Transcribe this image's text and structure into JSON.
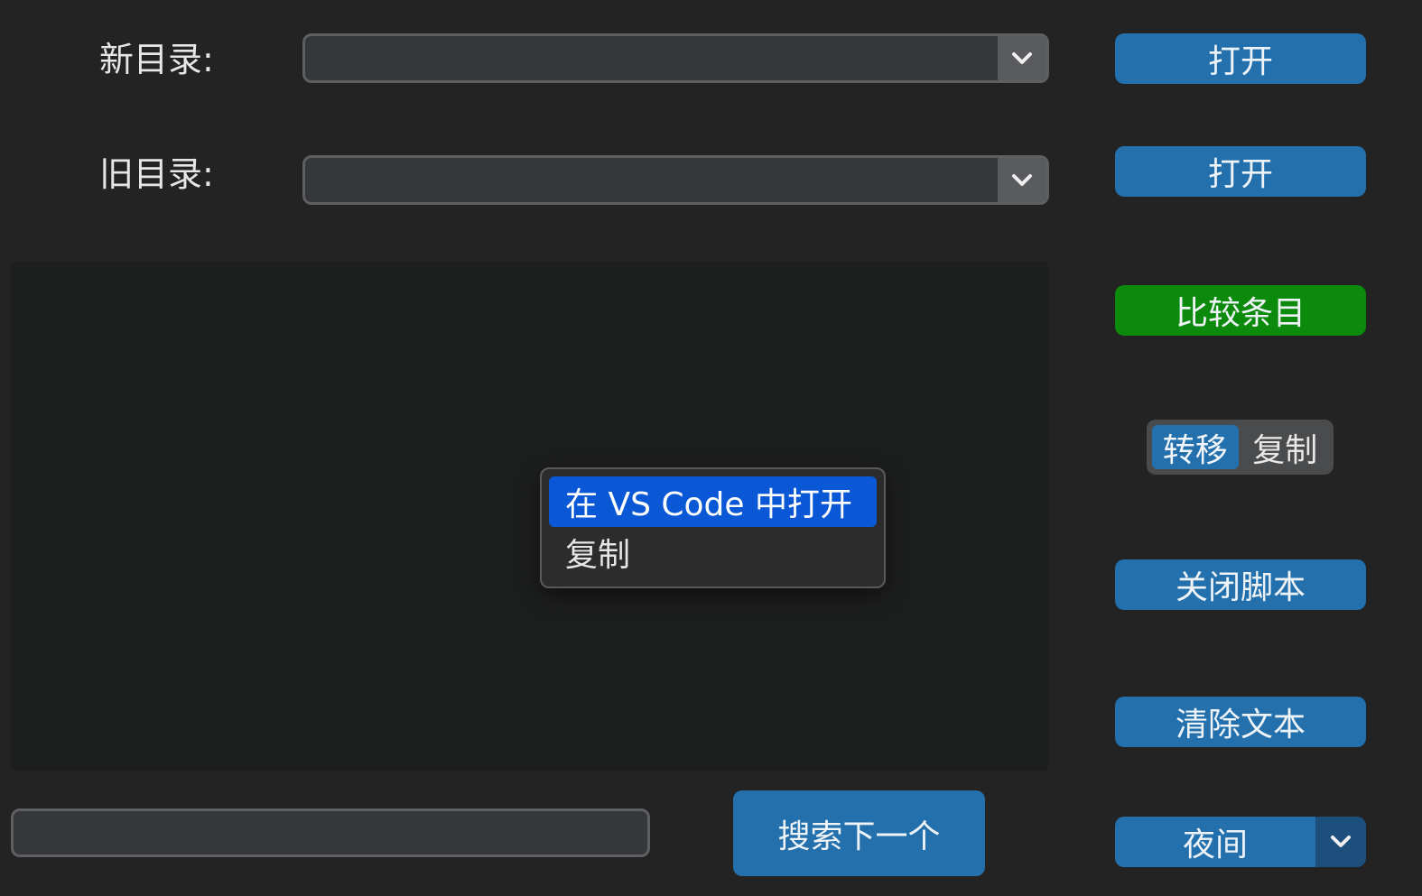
{
  "form": {
    "new_dir_label": "新目录:",
    "old_dir_label": "旧目录:",
    "new_dir_value": "",
    "old_dir_value": ""
  },
  "buttons": {
    "open_new": "打开",
    "open_old": "打开",
    "compare": "比较条目",
    "close_script": "关闭脚本",
    "clear_text": "清除文本",
    "search_next": "搜索下一个"
  },
  "mode_toggle": {
    "options": [
      "转移",
      "复制"
    ],
    "selected": "转移"
  },
  "context_menu": {
    "items": [
      "在 VS Code 中打开",
      "复制"
    ],
    "highlighted": "在 VS Code 中打开"
  },
  "search": {
    "value": ""
  },
  "theme_select": {
    "selected": "夜间"
  },
  "colors": {
    "accent": "#2370ad",
    "compare_green": "#0b8a0b",
    "menu_highlight": "#0a58d6",
    "background": "#232323"
  },
  "icons": {
    "dropdown": "chevron-down-icon"
  }
}
